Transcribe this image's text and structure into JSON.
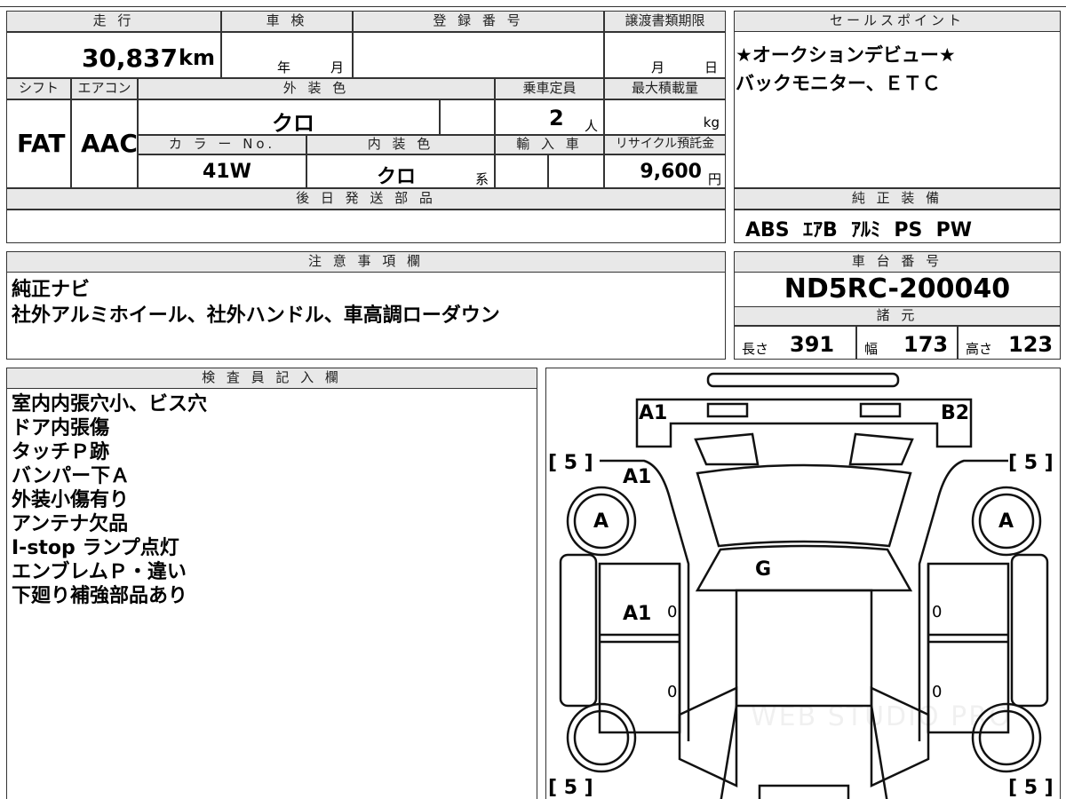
{
  "header": {
    "mileage_label": "走 行",
    "shaken_label": "車 検",
    "reg_label": "登 録 番 号",
    "transfer_label": "譲渡書類期限",
    "sales_label": "セールスポイント"
  },
  "mileage": {
    "value": "30,837",
    "unit": "km"
  },
  "shaken": {
    "year": "年",
    "month": "月"
  },
  "transfer": {
    "month": "月",
    "day": "日"
  },
  "sales_points": [
    "★オークションデビュー★",
    "バックモニター、ＥＴＣ"
  ],
  "row2": {
    "shift_label": "シフト",
    "ac_label": "エアコン",
    "ext_color_label": "外 装 色",
    "capacity_label": "乗車定員",
    "max_load_label": "最大積載量",
    "shift": "FAT",
    "ac": "AAC",
    "ext_color": "クロ",
    "capacity": "2",
    "capacity_unit": "人",
    "load_unit": "kg",
    "color_no_label": "カ ラ ー No.",
    "int_color_label": "内 装 色",
    "import_label": "輸 入 車",
    "recycle_label": "リサイクル預託金",
    "color_no": "41W",
    "int_color": "クロ",
    "int_suffix": "系",
    "recycle": "9,600",
    "recycle_unit": "円"
  },
  "later_parts_label": "後 日 発 送 部 品",
  "equipment": {
    "label": "純 正 装 備",
    "value": "ABS  ｴｱB  ｱﾙﾐ  PS  PW"
  },
  "notes": {
    "label": "注 意 事 項 欄",
    "lines": [
      "純正ナビ",
      "社外アルミホイール、社外ハンドル、車高調ローダウン"
    ]
  },
  "chassis": {
    "label": "車 台 番 号",
    "value": "ND5RC-200040"
  },
  "specs": {
    "label": "諸 元",
    "length_label": "長さ",
    "length": "391",
    "width_label": "幅",
    "width": "173",
    "height_label": "高さ",
    "height": "123"
  },
  "inspector": {
    "label": "検 査 員 記 入 欄",
    "lines": [
      "室内内張穴小、ビス穴",
      "ドア内張傷",
      "タッチＰ跡",
      "バンパー下Ａ",
      "外装小傷有り",
      "アンテナ欠品",
      "I-stop ランプ点灯",
      "エンブレムＰ・違い",
      "下廻り補強部品あり"
    ]
  },
  "diagram": {
    "marks": {
      "a1_front": "A1",
      "b2_front": "B2",
      "a1_hood_left": "A1",
      "a_left": "A",
      "a_right": "A",
      "g_glass": "G",
      "a1_door": "A1"
    },
    "tire_left_front": "[ 5 ]",
    "tire_right_front": "[ 5 ]",
    "tire_left_rear": "[ 5 ]",
    "tire_right_rear": "[ 5 ]",
    "zero": "0",
    "watermark": "WEB STUDIO PRO"
  }
}
